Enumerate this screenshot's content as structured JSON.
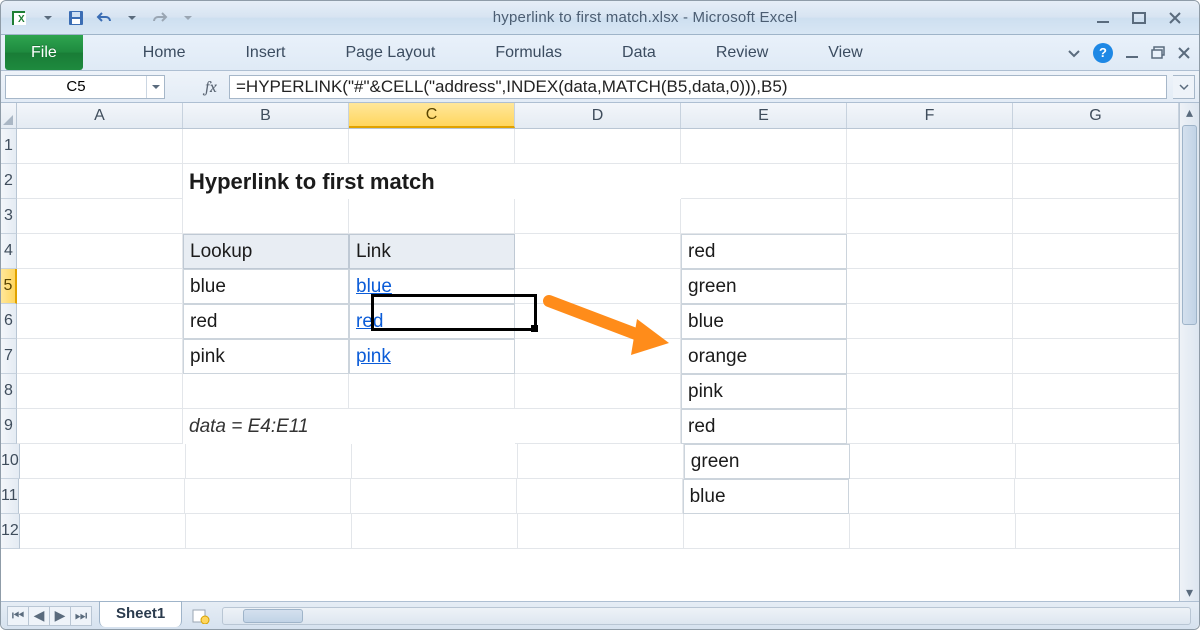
{
  "window": {
    "title": "hyperlink to first match.xlsx  -  Microsoft Excel"
  },
  "ribbon": {
    "file": "File",
    "tabs": [
      "Home",
      "Insert",
      "Page Layout",
      "Formulas",
      "Data",
      "Review",
      "View"
    ]
  },
  "namebox": "C5",
  "fx_label": "fx",
  "formula": "=HYPERLINK(\"#\"&CELL(\"address\",INDEX(data,MATCH(B5,data,0))),B5)",
  "columns": [
    "A",
    "B",
    "C",
    "D",
    "E",
    "F",
    "G"
  ],
  "rows": [
    "1",
    "2",
    "3",
    "4",
    "5",
    "6",
    "7",
    "8",
    "9",
    "10",
    "11",
    "12"
  ],
  "selected": {
    "row": "5",
    "col": "C"
  },
  "sheet": {
    "title": "Hyperlink to first match",
    "table_headers": {
      "lookup": "Lookup",
      "link": "Link"
    },
    "lookup_rows": [
      {
        "lookup": "blue",
        "link": "blue"
      },
      {
        "lookup": "red",
        "link": "red"
      },
      {
        "lookup": "pink",
        "link": "pink"
      }
    ],
    "e_list": [
      "red",
      "green",
      "blue",
      "orange",
      "pink",
      "red",
      "green",
      "blue"
    ],
    "note": "data = E4:E11"
  },
  "tabs": {
    "sheet1": "Sheet1"
  }
}
